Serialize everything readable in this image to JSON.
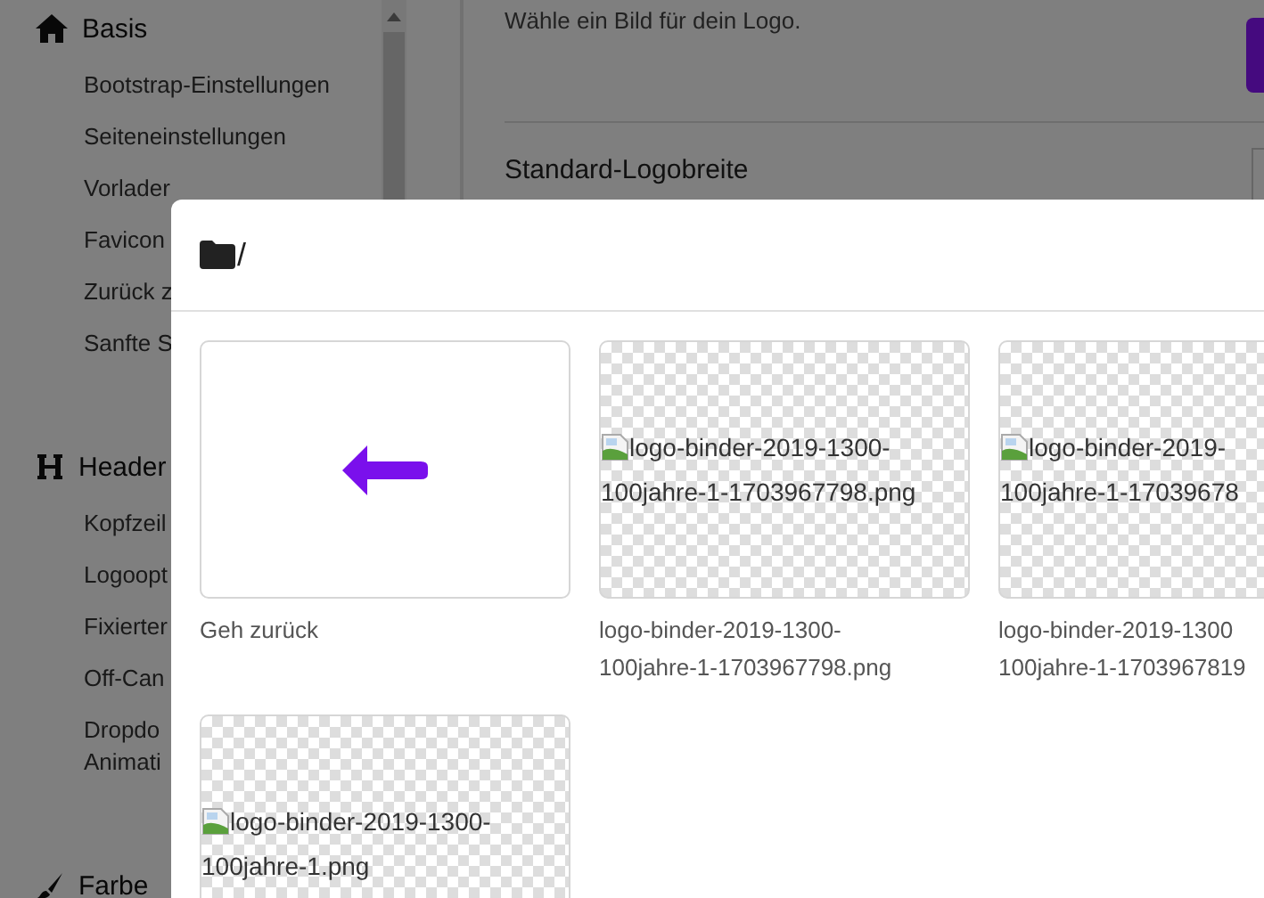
{
  "sidebar": {
    "sections": [
      {
        "title": "Basis",
        "items": [
          "Bootstrap-Einstellungen",
          "Seiteneinstellungen",
          "Vorlader",
          "Favicon",
          "Zurück z",
          "Sanfte S"
        ]
      },
      {
        "title": "Header",
        "items": [
          "Kopfzeil",
          "Logoopt",
          "Fixierter",
          "Off-Can",
          "Dropdo\nAnimati"
        ]
      },
      {
        "title": "Farbe"
      }
    ]
  },
  "main": {
    "description": "Wähle ein Bild für dein Logo.",
    "field_label": "Standard-Logobreite"
  },
  "modal": {
    "path": "/",
    "back": {
      "label": "Geh zurück"
    },
    "files": [
      {
        "alt": [
          "logo-binder-2019-1300-",
          "100jahre-1-1703967798.png"
        ],
        "label": [
          "logo-binder-2019-1300-",
          "100jahre-1-1703967798.png"
        ]
      },
      {
        "alt": [
          "logo-binder-2019-",
          "100jahre-1-17039678"
        ],
        "label": [
          "logo-binder-2019-1300",
          "100jahre-1-1703967819"
        ]
      },
      {
        "alt": [
          "logo-binder-2019-1300-",
          "100jahre-1.png"
        ]
      }
    ]
  }
}
